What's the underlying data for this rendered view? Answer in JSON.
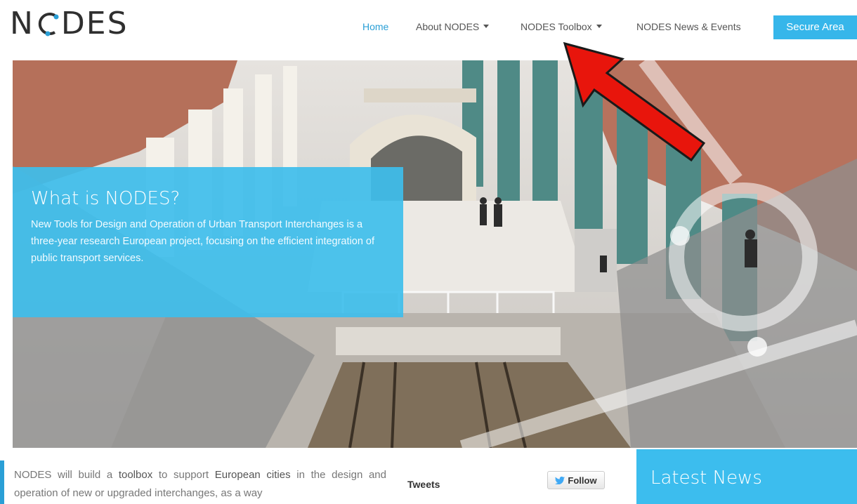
{
  "brand": {
    "logo_text_left": "N",
    "logo_text_right": "DES"
  },
  "nav": {
    "home": "Home",
    "about": "About NODES",
    "toolbox": "NODES Toolbox",
    "news": "NODES News & Events",
    "secure": "Secure Area"
  },
  "hero": {
    "title": "What is NODES?",
    "text": "New Tools for Design and Operation of Urban Transport Interchanges is a three-year research European project, focusing on the efficient integration of public transport services."
  },
  "intro": {
    "p1": "NODES will build a ",
    "b1": "toolbox",
    "p2": " to support ",
    "b2": "European cities",
    "p3": " in the design and operation of new or upgraded interchanges, as a way"
  },
  "tweets": {
    "title": "Tweets",
    "follow": "Follow"
  },
  "news": {
    "title": "Latest News"
  },
  "colors": {
    "accent": "#2a9fd6",
    "panel": "#3cbdee",
    "arrow": "#e8150c"
  }
}
